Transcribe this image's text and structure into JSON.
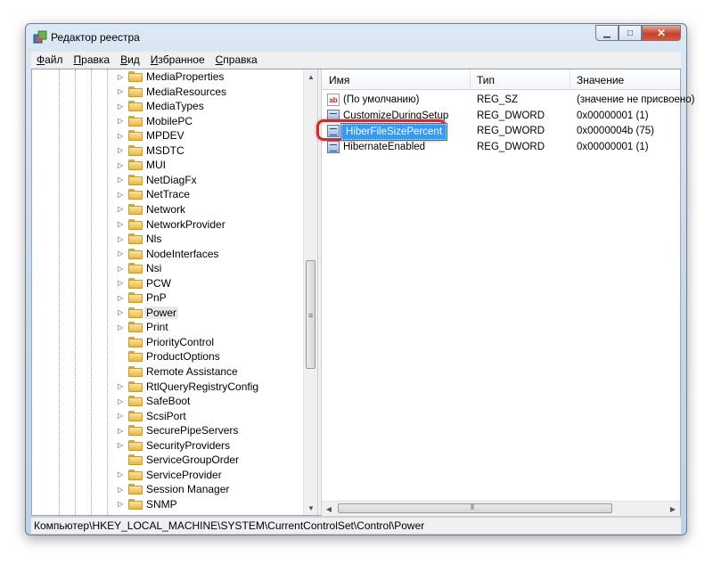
{
  "window": {
    "title": "Редактор реестра"
  },
  "menu": [
    "Файл",
    "Правка",
    "Вид",
    "Избранное",
    "Справка"
  ],
  "tree": {
    "items": [
      {
        "label": "MediaProperties",
        "has_children": true
      },
      {
        "label": "MediaResources",
        "has_children": true
      },
      {
        "label": "MediaTypes",
        "has_children": true
      },
      {
        "label": "MobilePC",
        "has_children": true
      },
      {
        "label": "MPDEV",
        "has_children": true
      },
      {
        "label": "MSDTC",
        "has_children": true
      },
      {
        "label": "MUI",
        "has_children": true
      },
      {
        "label": "NetDiagFx",
        "has_children": true
      },
      {
        "label": "NetTrace",
        "has_children": true
      },
      {
        "label": "Network",
        "has_children": true
      },
      {
        "label": "NetworkProvider",
        "has_children": true
      },
      {
        "label": "Nls",
        "has_children": true
      },
      {
        "label": "NodeInterfaces",
        "has_children": true
      },
      {
        "label": "Nsi",
        "has_children": true
      },
      {
        "label": "PCW",
        "has_children": true
      },
      {
        "label": "PnP",
        "has_children": true
      },
      {
        "label": "Power",
        "has_children": true,
        "selected": true
      },
      {
        "label": "Print",
        "has_children": true
      },
      {
        "label": "PriorityControl",
        "has_children": false
      },
      {
        "label": "ProductOptions",
        "has_children": false
      },
      {
        "label": "Remote Assistance",
        "has_children": false
      },
      {
        "label": "RtlQueryRegistryConfig",
        "has_children": true
      },
      {
        "label": "SafeBoot",
        "has_children": true
      },
      {
        "label": "ScsiPort",
        "has_children": true
      },
      {
        "label": "SecurePipeServers",
        "has_children": true
      },
      {
        "label": "SecurityProviders",
        "has_children": true
      },
      {
        "label": "ServiceGroupOrder",
        "has_children": false
      },
      {
        "label": "ServiceProvider",
        "has_children": true
      },
      {
        "label": "Session Manager",
        "has_children": true
      },
      {
        "label": "SNMP",
        "has_children": true
      }
    ]
  },
  "list": {
    "columns": {
      "name": "Имя",
      "type": "Тип",
      "data": "Значение"
    },
    "rows": [
      {
        "icon": "string-value-icon",
        "name": "(По умолчанию)",
        "type": "REG_SZ",
        "data": "(значение не присвоено)"
      },
      {
        "icon": "dword-value-icon",
        "name": "CustomizeDuringSetup",
        "type": "REG_DWORD",
        "data": "0x00000001 (1)"
      },
      {
        "icon": "dword-value-icon",
        "name": "HiberFileSizePercent",
        "type": "REG_DWORD",
        "data": "0x0000004b (75)",
        "selected": true
      },
      {
        "icon": "dword-value-icon",
        "name": "HibernateEnabled",
        "type": "REG_DWORD",
        "data": "0x00000001 (1)"
      }
    ]
  },
  "statusbar": {
    "path": "Компьютер\\HKEY_LOCAL_MACHINE\\SYSTEM\\CurrentControlSet\\Control\\Power"
  },
  "colors": {
    "highlight_ring": "#d8282a",
    "selection": "#3399ff"
  }
}
